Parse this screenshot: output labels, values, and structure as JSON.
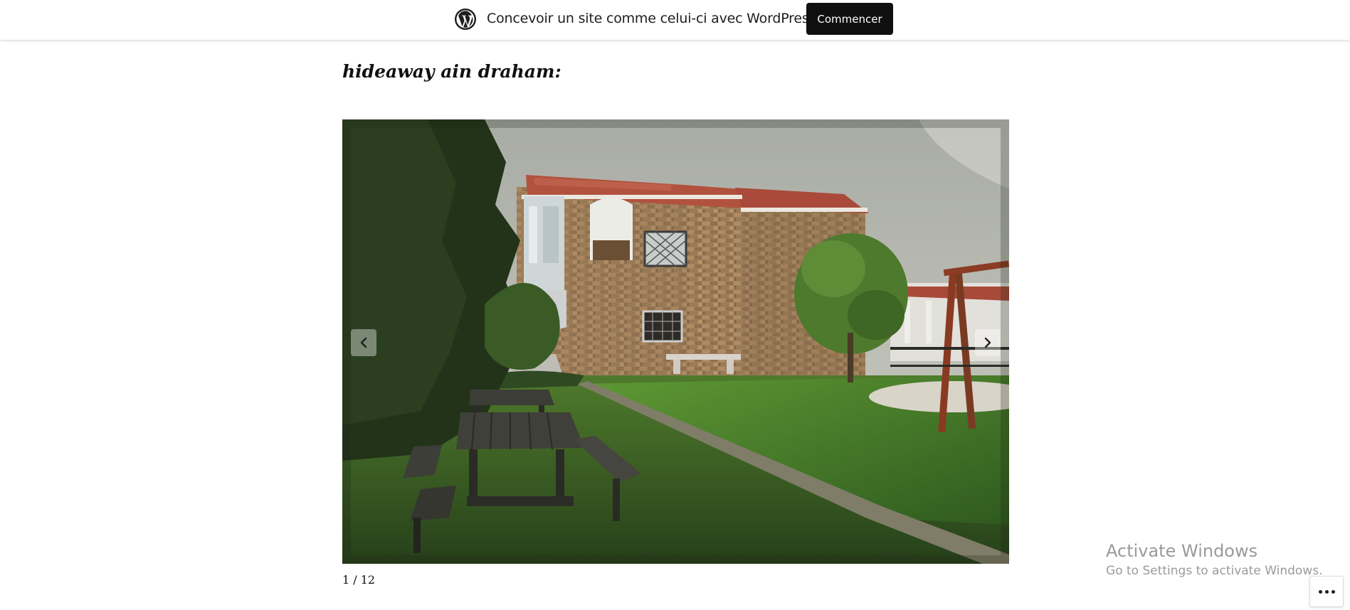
{
  "banner": {
    "logo_icon": "wordpress-logo-icon",
    "text": "Concevoir un site comme celui-ci avec WordPress.com",
    "cta_label": "Commencer"
  },
  "post": {
    "title": "hideaway ain draham:"
  },
  "slideshow": {
    "image_description_icon": "stone-house-garden-photo",
    "prev_icon": "chevron-left-icon",
    "next_icon": "chevron-right-icon",
    "current": 1,
    "total": 12,
    "counter": "1 / 12"
  },
  "watermark": {
    "title": "Activate Windows",
    "subtitle": "Go to Settings to activate Windows."
  },
  "actions": {
    "more_icon": "ellipsis-icon"
  },
  "colors": {
    "cta_background": "#101010",
    "cta_text": "#ffffff",
    "title_text": "#111111"
  }
}
